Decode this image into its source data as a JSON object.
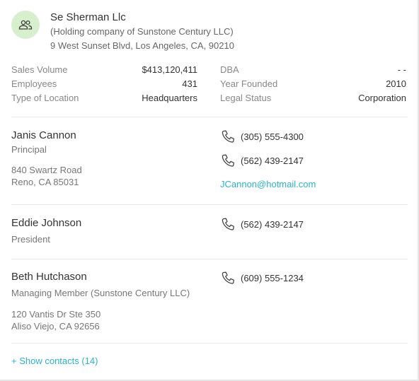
{
  "company": {
    "name": "Se Sherman Llc",
    "parent": "(Holding company of Sunstone Century LLC)",
    "address": "9 West Sunset Blvd, Los Angeles, CA, 90210",
    "avatar_icon": "people-icon",
    "avatar_color": "#d8efce"
  },
  "details_left": [
    {
      "label": "Sales Volume",
      "value": "$413,120,411"
    },
    {
      "label": "Employees",
      "value": "431"
    },
    {
      "label": "Type of Location",
      "value": "Headquarters"
    }
  ],
  "details_right": [
    {
      "label": "DBA",
      "value": "- -"
    },
    {
      "label": "Year Founded",
      "value": "2010"
    },
    {
      "label": "Legal Status",
      "value": "Corporation"
    }
  ],
  "contacts": [
    {
      "name": "Janis Cannon",
      "title": "Principal",
      "address_line1": "840 Swartz Road",
      "address_line2": "Reno, CA 85031",
      "phones": [
        "(305) 555-4300",
        "(562) 439-2147"
      ],
      "email": "JCannon@hotmail.com"
    },
    {
      "name": "Eddie Johnson",
      "title": "President",
      "phones": [
        "(562) 439-2147"
      ]
    },
    {
      "name": "Beth Hutchason",
      "title": "Managing Member (Sunstone Century LLC)",
      "address_line1": "120 Vantis Dr Ste 350",
      "address_line2": "Aliso Viejo, CA 92656",
      "phones": [
        "(609) 555-1234"
      ]
    }
  ],
  "show_contacts_label": "+ Show contacts (14)",
  "colors": {
    "link": "#2ab3c9",
    "divider": "#e8e8e8"
  }
}
